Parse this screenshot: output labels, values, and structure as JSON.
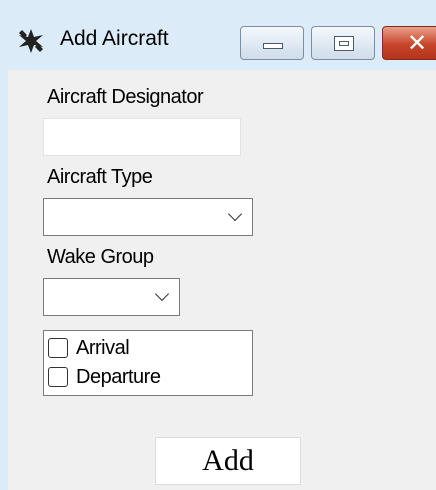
{
  "window": {
    "title": "Add Aircraft",
    "app_icon": "aircraft-icon",
    "minimize_icon": "minimize-icon",
    "maximize_icon": "maximize-icon",
    "close_icon": "close-icon",
    "close_glyph": "✕"
  },
  "form": {
    "designator_label": "Aircraft Designator",
    "designator_value": "",
    "type_label": "Aircraft Type",
    "type_value": "",
    "wake_label": "Wake Group",
    "wake_value": "",
    "flight_modes": [
      {
        "label": "Arrival",
        "checked": false
      },
      {
        "label": "Departure",
        "checked": false
      }
    ],
    "add_label": "Add"
  },
  "colors": {
    "titlebar": "#dcebf8",
    "client": "#f0f0f0",
    "close_button": "#c8452c"
  }
}
